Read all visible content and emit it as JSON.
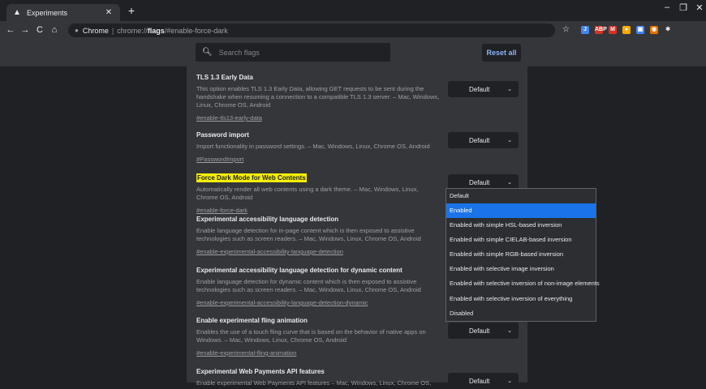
{
  "tab": {
    "title": "Experiments",
    "close": "✕",
    "new": "+"
  },
  "window": {
    "minimize": "–",
    "maximize": "❐",
    "close": "✕"
  },
  "nav": {
    "back": "←",
    "forward": "→",
    "reload": "C",
    "home": "⌂"
  },
  "omnibox": {
    "site_name": "Chrome",
    "separator": "|",
    "url_prefix": "chrome://",
    "url_bold": "flags",
    "url_suffix": "/#enable-force-dark"
  },
  "toolbar_star": "☆",
  "extensions": [
    {
      "label": "J",
      "color": "#4285f4"
    },
    {
      "label": "ABP",
      "color": "#d93025"
    },
    {
      "label": "M",
      "color": "#d93025"
    },
    {
      "label": "●",
      "color": "#f9ab00"
    },
    {
      "label": "▣",
      "color": "#4285f4"
    },
    {
      "label": "◉",
      "color": "#e37400"
    },
    {
      "label": "✱",
      "color": "#e8eaed"
    }
  ],
  "search": {
    "placeholder": "Search flags"
  },
  "reset_label": "Reset all",
  "flags": [
    {
      "title": "TLS 1.3 Early Data",
      "description": "This option enables TLS 1.3 Early Data, allowing GET requests to be sent during the handshake when resuming a connection to a compatible TLS 1.3 server. – Mac, Windows, Linux, Chrome OS, Android",
      "link": "#enable-tls13-early-data",
      "value": "Default"
    },
    {
      "title": "Password import",
      "description": "Import functionality in password settings. – Mac, Windows, Linux, Chrome OS, Android",
      "link": "#PasswordImport",
      "value": "Default"
    },
    {
      "title": "Force Dark Mode for Web Contents",
      "description": "Automatically render all web contents using a dark theme. – Mac, Windows, Linux, Chrome OS, Android",
      "link": "#enable-force-dark",
      "value": "Default"
    },
    {
      "title": "Experimental accessibility language detection",
      "description": "Enable language detection for in-page content which is then exposed to assistive technologies such as screen readers. – Mac, Windows, Linux, Chrome OS, Android",
      "link": "#enable-experimental-accessibility-language-detection",
      "value": ""
    },
    {
      "title": "Experimental accessibility language detection for dynamic content",
      "description": "Enable language detection for dynamic content which is then exposed to assistive technologies such as screen readers. – Mac, Windows, Linux, Chrome OS, Android",
      "link": "#enable-experimental-accessibility-language-detection-dynamic",
      "value": ""
    },
    {
      "title": "Enable experimental fling animation",
      "description": "Enables the use of a touch fling curve that is based on the behavior of native apps on Windows. – Mac, Windows, Linux, Chrome OS, Android",
      "link": "#enable-experimental-fling-animation",
      "value": "Default"
    },
    {
      "title": "Experimental Web Payments API features",
      "description": "Enable experimental Web Payments API features – Mac, Windows, Linux, Chrome OS,",
      "link": "",
      "value": "Default"
    }
  ],
  "dropdown_options": [
    "Default",
    "Enabled",
    "Enabled with simple HSL-based inversion",
    "Enabled with simple CIELAB-based inversion",
    "Enabled with simple RGB-based inversion",
    "Enabled with selective image inversion",
    "Enabled with selective inversion of non-image elements",
    "Enabled with selective inversion of everything",
    "Disabled"
  ],
  "dropdown_selected_index": 1,
  "select_arrow": "⌄"
}
